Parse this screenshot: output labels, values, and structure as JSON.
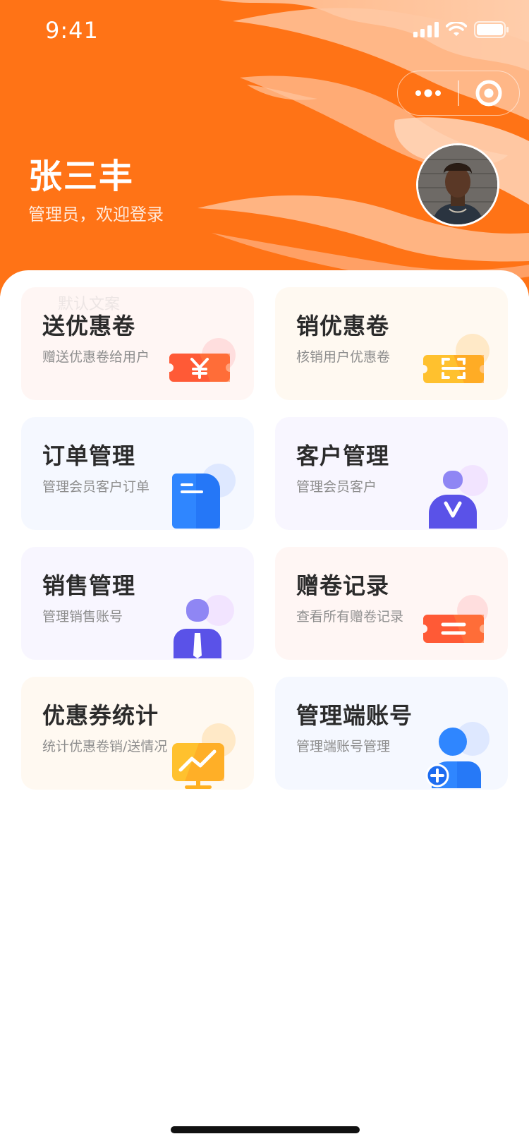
{
  "status_bar": {
    "time": "9:41"
  },
  "user": {
    "name": "张三丰",
    "subtitle": "管理员，欢迎登录"
  },
  "ghost_text": "默认文案",
  "cards": [
    {
      "title": "送优惠卷",
      "desc": "赠送优惠卷给用户",
      "icon": "yuan-ticket-icon",
      "bg": "#fff6f4"
    },
    {
      "title": "销优惠卷",
      "desc": "核销用户优惠卷",
      "icon": "scan-ticket-icon",
      "bg": "#fff9f1"
    },
    {
      "title": "订单管理",
      "desc": "管理会员客户订单",
      "icon": "document-icon",
      "bg": "#f5f8ff"
    },
    {
      "title": "客户管理",
      "desc": "管理会员客户",
      "icon": "customer-icon",
      "bg": "#f8f6ff"
    },
    {
      "title": "销售管理",
      "desc": "管理销售账号",
      "icon": "salesperson-icon",
      "bg": "#f8f6ff"
    },
    {
      "title": "赠卷记录",
      "desc": "查看所有赠卷记录",
      "icon": "coupon-record-icon",
      "bg": "#fff6f4"
    },
    {
      "title": "优惠券统计",
      "desc": "统计优惠卷销/送情况",
      "icon": "statistics-chart-icon",
      "bg": "#fff9f1"
    },
    {
      "title": "管理端账号",
      "desc": "管理端账号管理",
      "icon": "add-account-icon",
      "bg": "#f5f8ff"
    }
  ],
  "colors": {
    "header_orange": "#ff7316",
    "accent_red": "#ff5a36",
    "accent_yellow": "#ffc12e",
    "accent_blue": "#2f86ff",
    "accent_purple": "#5a52e8"
  }
}
